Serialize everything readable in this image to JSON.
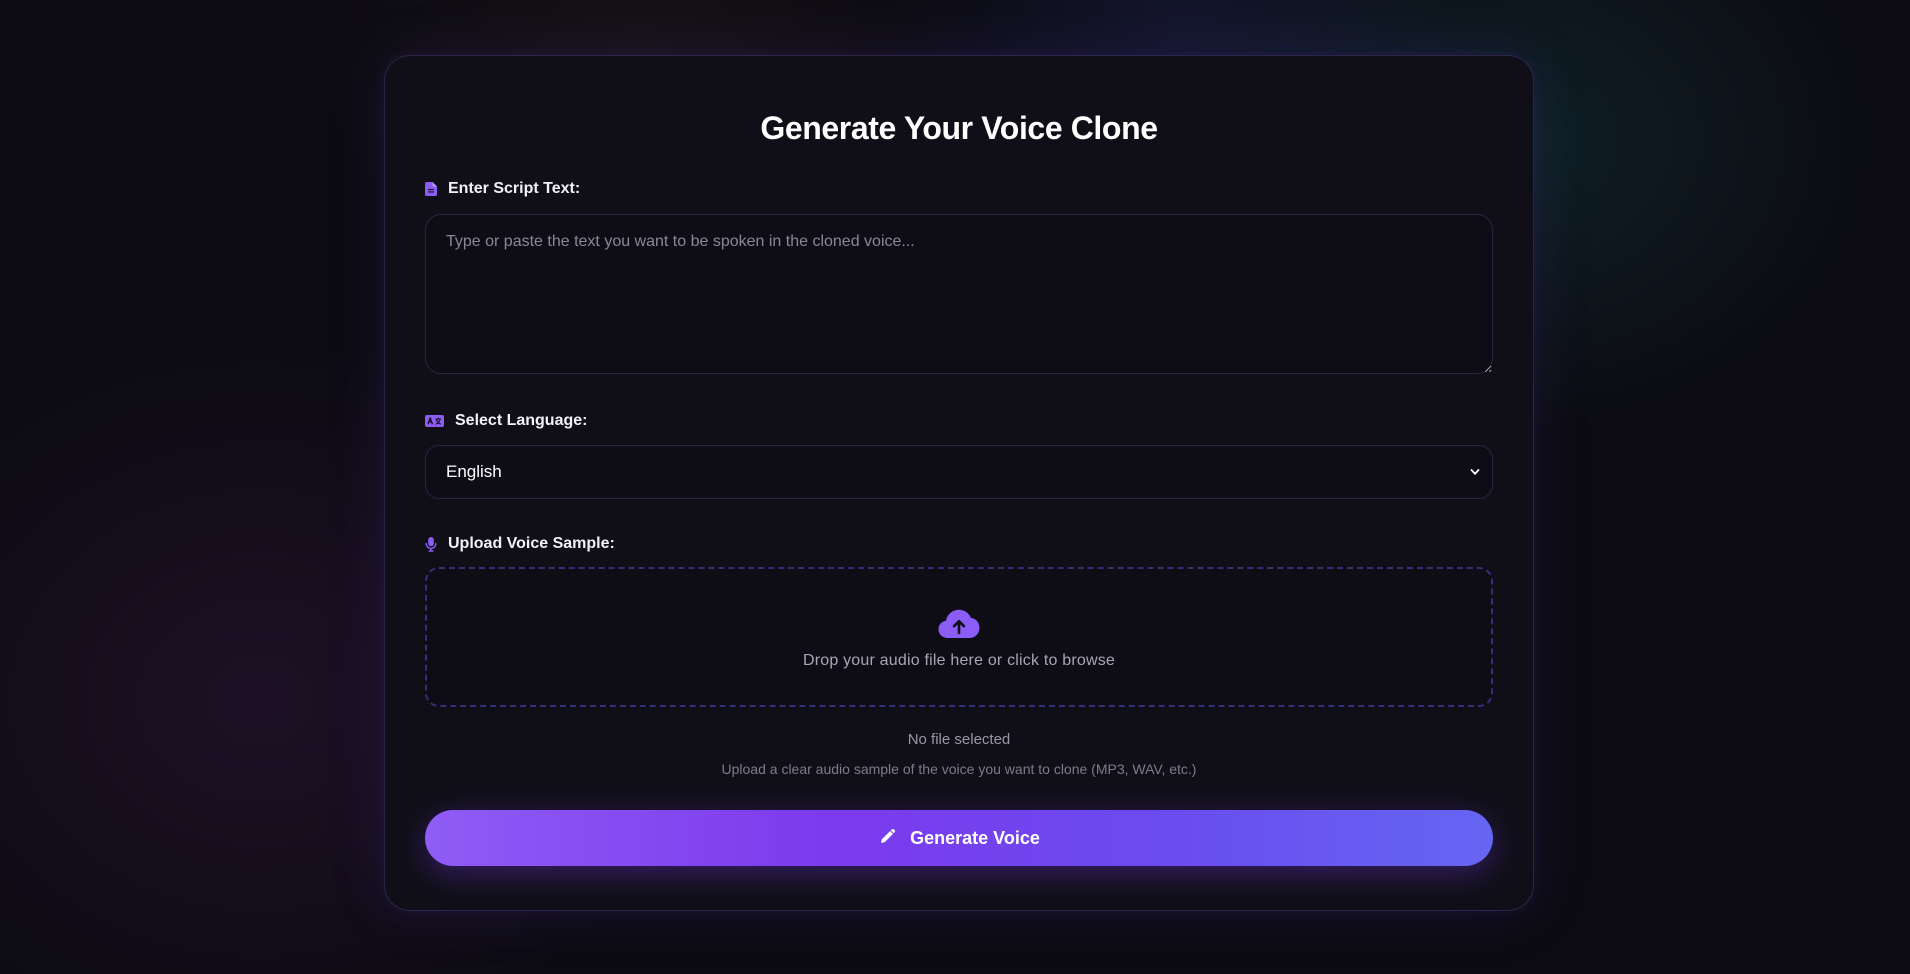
{
  "page": {
    "title": "Generate Your Voice Clone"
  },
  "script": {
    "label": "Enter Script Text:",
    "placeholder": "Type or paste the text you want to be spoken in the cloned voice...",
    "value": "",
    "icon": "document-icon"
  },
  "language": {
    "label": "Select Language:",
    "selected": "English",
    "icon": "language-icon"
  },
  "upload": {
    "label": "Upload Voice Sample:",
    "icon": "microphone-icon",
    "drop_text": "Drop your audio file here or click to browse",
    "drop_icon": "cloud-upload-icon",
    "file_status": "No file selected",
    "hint": "Upload a clear audio sample of the voice you want to clone (MP3, WAV, etc.)"
  },
  "action": {
    "generate_label": "Generate Voice",
    "icon": "pencil-icon"
  },
  "colors": {
    "accent": "#8b5cf6",
    "background": "#0c0b12",
    "card": "#100f18",
    "button_gradient_start": "#8f5cf6",
    "button_gradient_end": "#6566f2"
  }
}
